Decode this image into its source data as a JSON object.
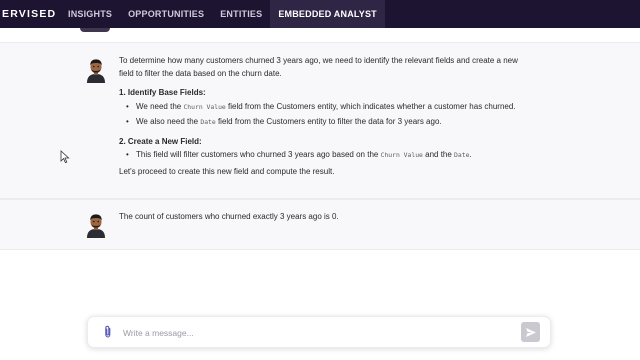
{
  "brand": "ERVISED",
  "nav": {
    "items": [
      {
        "label": "INSIGHTS"
      },
      {
        "label": "OPPORTUNITIES"
      },
      {
        "label": "ENTITIES"
      },
      {
        "label": "EMBEDDED ANALYST"
      }
    ],
    "active": "EMBEDDED ANALYST"
  },
  "messages": [
    {
      "intro": "To determine how many customers churned 3 years ago, we need to identify the relevant fields and create a new field to filter the data based on the churn date.",
      "sections": [
        {
          "number": "1.",
          "title": "Identify Base Fields:",
          "bullets": [
            {
              "pre": "We need the ",
              "code": "Churn Value",
              "post": " field from the Customers entity, which indicates whether a customer has churned."
            },
            {
              "pre": "We also need the ",
              "code": "Date",
              "post": " field from the Customers entity to filter the data for 3 years ago."
            }
          ]
        },
        {
          "number": "2.",
          "title": "Create a New Field:",
          "bullets": [
            {
              "pre": "This field will filter customers who churned 3 years ago based on the ",
              "code": "Churn Value",
              "mid": " and the ",
              "code2": "Date",
              "post": "."
            }
          ]
        }
      ],
      "outro": "Let's proceed to create this new field and compute the result."
    },
    {
      "text": "The count of customers who churned exactly 3 years ago is 0."
    }
  ],
  "composer": {
    "placeholder": "Write a message...",
    "value": ""
  },
  "icons": {
    "attach": "paperclip-icon",
    "send": "send-icon",
    "avatar": "analyst-avatar-icon",
    "cursor": "mouse-cursor-icon"
  },
  "colors": {
    "topbar": "#1c1430",
    "active_tab": "#2f2545",
    "message_bg": "#f8f8fa",
    "accent": "#5a5ab8",
    "send_disabled": "#c9c9cf"
  }
}
